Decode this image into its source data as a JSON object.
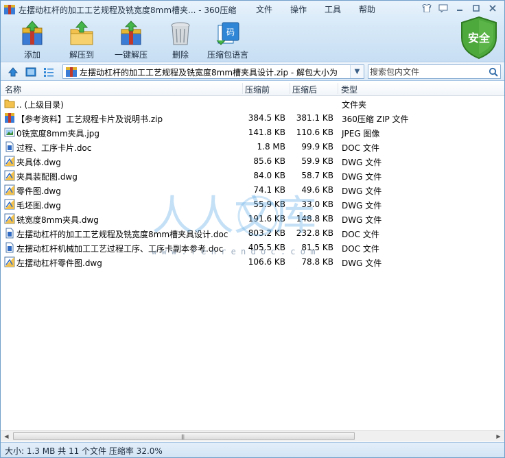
{
  "window": {
    "title": "左摆动杠杆的加工工艺规程及铣宽度8mm槽夹... - 360压缩"
  },
  "menu": [
    "文件",
    "操作",
    "工具",
    "帮助"
  ],
  "toolbar": {
    "add": "添加",
    "extract_to": "解压到",
    "one_click_extract": "一键解压",
    "delete": "删除",
    "archive_language": "压缩包语言"
  },
  "safe_badge": "安全",
  "addressbar": {
    "path": "左摆动杠杆的加工工艺规程及铣宽度8mm槽夹具设计.zip - 解包大小为",
    "search_placeholder": "搜索包内文件"
  },
  "columns": {
    "name": "名称",
    "compressed": "压缩前",
    "packed": "压缩后",
    "type": "类型"
  },
  "files": [
    {
      "name": ".. (上级目录)",
      "size": "",
      "packed": "",
      "type": "文件夹",
      "icon": "folder-icon"
    },
    {
      "name": "【参考资料】工艺规程卡片及说明书.zip",
      "size": "384.5 KB",
      "packed": "381.1 KB",
      "type": "360压缩 ZIP 文件",
      "icon": "zip-icon"
    },
    {
      "name": "0铣宽度8mm夹具.jpg",
      "size": "141.8 KB",
      "packed": "110.6 KB",
      "type": "JPEG 图像",
      "icon": "jpeg-icon"
    },
    {
      "name": "过程、工序卡片.doc",
      "size": "1.8 MB",
      "packed": "99.9 KB",
      "type": "DOC 文件",
      "icon": "doc-icon"
    },
    {
      "name": "夹具体.dwg",
      "size": "85.6 KB",
      "packed": "59.9 KB",
      "type": "DWG 文件",
      "icon": "dwg-icon"
    },
    {
      "name": "夹具装配图.dwg",
      "size": "84.0 KB",
      "packed": "58.7 KB",
      "type": "DWG 文件",
      "icon": "dwg-icon"
    },
    {
      "name": "零件图.dwg",
      "size": "74.1 KB",
      "packed": "49.6 KB",
      "type": "DWG 文件",
      "icon": "dwg-icon"
    },
    {
      "name": "毛坯图.dwg",
      "size": "55.9 KB",
      "packed": "33.0 KB",
      "type": "DWG 文件",
      "icon": "dwg-icon"
    },
    {
      "name": "铣宽度8mm夹具.dwg",
      "size": "191.6 KB",
      "packed": "148.8 KB",
      "type": "DWG 文件",
      "icon": "dwg-icon"
    },
    {
      "name": "左摆动杠杆的加工工艺规程及铣宽度8mm槽夹具设计.doc",
      "size": "803.2 KB",
      "packed": "232.8 KB",
      "type": "DOC 文件",
      "icon": "doc-icon"
    },
    {
      "name": "左摆动杠杆机械加工工艺过程工序、工序卡副本参考.doc",
      "size": "405.5 KB",
      "packed": "81.5 KB",
      "type": "DOC 文件",
      "icon": "doc-icon"
    },
    {
      "name": "左摆动杠杆零件图.dwg",
      "size": "106.6 KB",
      "packed": "78.8 KB",
      "type": "DWG 文件",
      "icon": "dwg-icon"
    }
  ],
  "status": "大小: 1.3 MB 共 11 个文件 压缩率 32.0%",
  "watermark": {
    "text": "人人文库",
    "url": "w w w . r e n r e n d o c . c o m"
  },
  "colors": {
    "title_bar": "#d7e9f8",
    "border": "#6f9fc9",
    "safe_shield": "#4ea93d",
    "watermark": "#5aa9e6"
  }
}
